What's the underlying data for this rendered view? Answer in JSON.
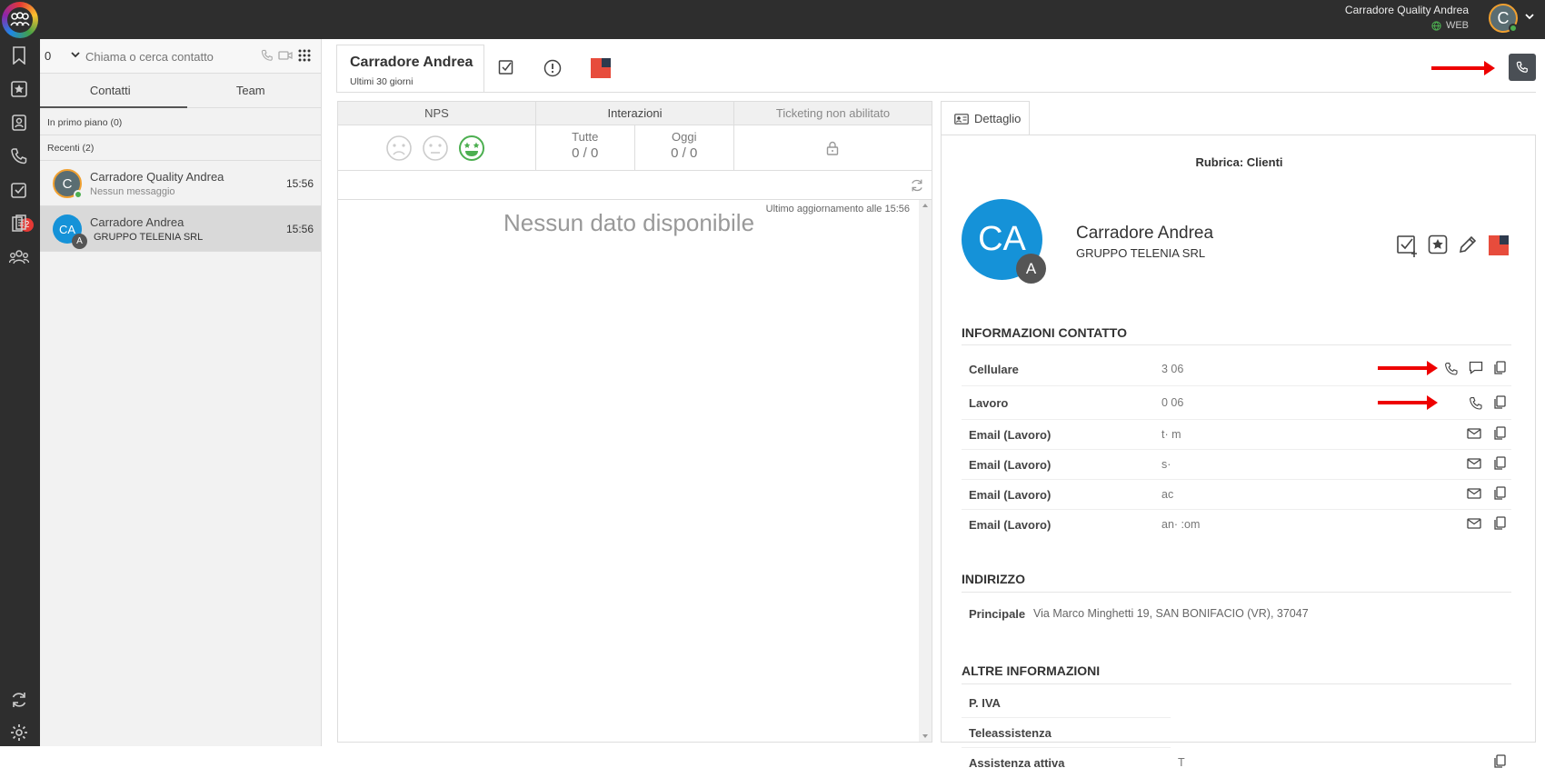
{
  "topbar": {
    "user_name": "Carradore Quality Andrea",
    "status": "WEB",
    "avatar_letter": "C"
  },
  "nav": {
    "tasks_badge": "2"
  },
  "sidepanel": {
    "line_value": "0",
    "search_placeholder": "Chiama o cerca contatto",
    "tabs": [
      "Contatti",
      "Team"
    ],
    "section_foreground": "In primo piano (0)",
    "section_recent": "Recenti (2)",
    "contacts": [
      {
        "avatar": "C",
        "name": "Carradore Quality Andrea",
        "sub": "Nessun messaggio",
        "time": "15:56"
      },
      {
        "avatar": "CA",
        "avatar_badge": "A",
        "name": "Carradore Andrea",
        "sub": "GRUPPO TELENIA SRL",
        "time": "15:56"
      }
    ]
  },
  "header": {
    "title": "Carradore Andrea",
    "subtitle": "Ultimi 30 giorni"
  },
  "stats": {
    "nps_label": "NPS",
    "interazioni_label": "Interazioni",
    "ticketing_label": "Ticketing non abilitato",
    "tutte_label": "Tutte",
    "tutte_value": "0 / 0",
    "oggi_label": "Oggi",
    "oggi_value": "0 / 0",
    "last_update": "Ultimo aggiornamento alle 15:56",
    "no_data": "Nessun dato disponibile"
  },
  "detail": {
    "tab_label": "Dettaglio",
    "rubrica": "Rubrica: Clienti",
    "avatar": "CA",
    "avatar_badge": "A",
    "name": "Carradore Andrea",
    "company": "GRUPPO TELENIA SRL",
    "contact_heading": "INFORMAZIONI CONTATTO",
    "contacts": [
      {
        "label": "Cellulare",
        "value": "3              06"
      },
      {
        "label": "Lavoro",
        "value": "0              06"
      },
      {
        "label": "Email (Lavoro)",
        "value": "t·                              m"
      },
      {
        "label": "Email (Lavoro)",
        "value": "s·"
      },
      {
        "label": "Email (Lavoro)",
        "value": "ac"
      },
      {
        "label": "Email (Lavoro)",
        "value": "an·                          :om"
      }
    ],
    "address_heading": "INDIRIZZO",
    "address_label": "Principale",
    "address_value": "Via Marco Minghetti 19, SAN BONIFACIO (VR), 37047",
    "other_heading": "ALTRE INFORMAZIONI",
    "other": [
      {
        "label": "P. IVA",
        "value": ""
      },
      {
        "label": "Teleassistenza",
        "value": ""
      },
      {
        "label": "Assistenza attiva",
        "value": "T"
      }
    ]
  },
  "colors": {
    "accent_blue": "#1592d8",
    "dark": "#2e2e2e",
    "flag_red": "#e74c3c",
    "nps_green": "#4caf50",
    "annotation_red": "#e00000"
  }
}
